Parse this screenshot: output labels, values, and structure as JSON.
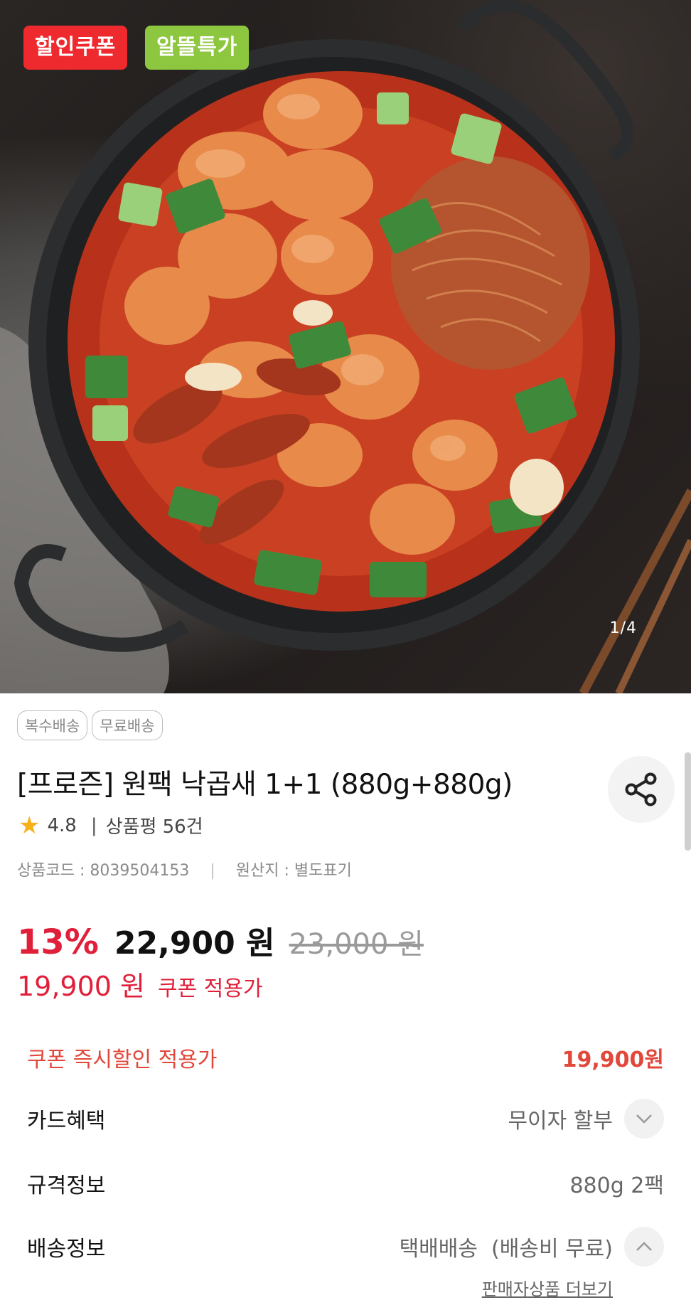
{
  "hero": {
    "badges": {
      "coupon": "할인쿠폰",
      "special": "알뜰특가"
    },
    "counter": "1/4"
  },
  "product": {
    "tags": [
      "복수배송",
      "무료배송"
    ],
    "title": "[프로즌] 원팩 낙곱새 1+1 (880g+880g)",
    "rating": "4.8",
    "review_label": "상품평 56건",
    "code_label": "상품코드 : 8039504153",
    "origin_label": "원산지 : 별도표기",
    "share_icon": "share-icon"
  },
  "price": {
    "discount_rate": "13%",
    "sale_price": "22,900 원",
    "original_price": "23,000 원",
    "coupon_price": "19,900 원",
    "coupon_text": "쿠폰 적용가"
  },
  "info": {
    "coupon_apply": {
      "label": "쿠폰 즉시할인 적용가",
      "value": "19,900원"
    },
    "card": {
      "label": "카드혜택",
      "value": "무이자 할부"
    },
    "spec": {
      "label": "규격정보",
      "value": "880g 2팩"
    },
    "delivery": {
      "label": "배송정보",
      "value": "택배배송  (배송비 무료)"
    },
    "more_link": "판매자상품 더보기"
  },
  "colors": {
    "accent_red": "#e0203a",
    "coupon_badge": "#ee2a2f",
    "special_badge": "#8dc63f"
  }
}
